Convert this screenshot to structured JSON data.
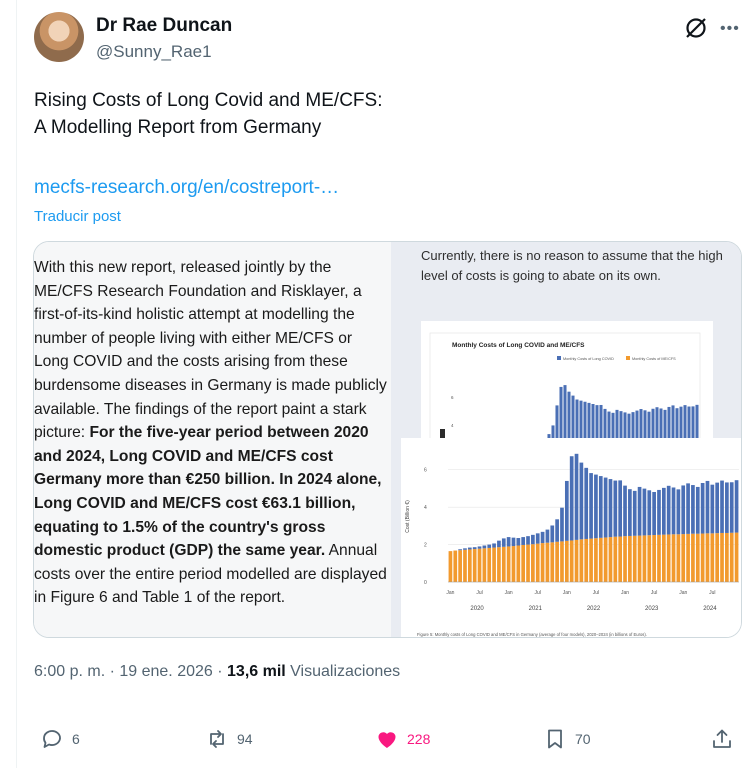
{
  "author": {
    "name": "Dr Rae Duncan",
    "handle": "@Sunny_Rae1"
  },
  "post": {
    "text_line1": "Rising Costs of Long Covid and ME/CFS:",
    "text_line2": "A Modelling Report from Germany",
    "link": "mecfs-research.org/en/costreport-…",
    "translate_label": "Traducir post"
  },
  "media": {
    "left_text_a": "With this new report, released jointly by the ME/CFS Research Foundation and Risklayer, a first-of-its-kind holistic attempt at modelling the number of people living with either ME/CFS or Long COVID and the costs arising from these burdensome diseases in Germany is made publicly available. The findings of the report paint a stark picture: ",
    "left_text_bold": "For the five-year period between 2020 and 2024, Long COVID and ME/CFS cost Germany more than €250 billion. In 2024 alone, Long COVID and ME/CFS cost €63.1 billion, equating to 1.5% of the country's gross domestic product (GDP) the same year.",
    "left_text_b": " Annual costs over the entire period modelled are displayed in Figure 6 and Table 1 of the report.",
    "right_text": "Currently, there is no reason to assume that the high level of costs is going to abate on its own.",
    "chart_title": "Monthly Costs of Long COVID and ME/CFS",
    "legend_lc": "Monthly Costs of Long COVID",
    "legend_me": "Monthly Costs of ME/CFS",
    "ylabel": "Cost (Billion €)",
    "month_ticks": [
      "Jan",
      "Jul",
      "Jan",
      "Jul",
      "Jan",
      "Jul",
      "Jan",
      "Jul",
      "Jan",
      "Jul"
    ],
    "year_ticks": [
      "2020",
      "2021",
      "2022",
      "2023",
      "2024"
    ],
    "y_ticks_big": [
      "0",
      "2",
      "4",
      "6"
    ],
    "y_ticks_small": [
      "6",
      "4"
    ],
    "caption": "Figure 5: Monthly costs of Long COVID and ME/CFS in Germany (average of four models), 2020–2024 (in billions of Euros)."
  },
  "chart_data": {
    "type": "bar",
    "title": "Monthly Costs of Long COVID and ME/CFS",
    "ylabel": "Cost (Billion €)",
    "ylim": [
      0,
      7
    ],
    "stacked": true,
    "legend": "top-right",
    "series": [
      {
        "name": "Monthly Costs of ME/CFS",
        "color": "#f29a2e",
        "values": [
          1.65,
          1.68,
          1.7,
          1.72,
          1.74,
          1.76,
          1.78,
          1.8,
          1.82,
          1.84,
          1.86,
          1.88,
          1.9,
          1.92,
          1.95,
          1.98,
          2.0,
          2.02,
          2.05,
          2.08,
          2.1,
          2.12,
          2.15,
          2.17,
          2.2,
          2.22,
          2.25,
          2.28,
          2.3,
          2.32,
          2.34,
          2.36,
          2.38,
          2.4,
          2.42,
          2.43,
          2.45,
          2.46,
          2.47,
          2.48,
          2.49,
          2.5,
          2.51,
          2.52,
          2.53,
          2.54,
          2.55,
          2.55,
          2.56,
          2.57,
          2.58,
          2.58,
          2.59,
          2.6,
          2.6,
          2.61,
          2.62,
          2.62,
          2.63,
          2.64
        ]
      },
      {
        "name": "Monthly Costs of Long COVID",
        "color": "#4a6fb5",
        "values": [
          0.0,
          0.0,
          0.05,
          0.08,
          0.1,
          0.1,
          0.12,
          0.15,
          0.18,
          0.22,
          0.35,
          0.45,
          0.5,
          0.45,
          0.4,
          0.42,
          0.45,
          0.5,
          0.55,
          0.6,
          0.7,
          0.9,
          1.2,
          1.8,
          3.2,
          4.5,
          4.6,
          4.1,
          3.8,
          3.5,
          3.4,
          3.3,
          3.2,
          3.1,
          3.0,
          3.0,
          2.7,
          2.5,
          2.4,
          2.6,
          2.5,
          2.4,
          2.3,
          2.4,
          2.5,
          2.6,
          2.5,
          2.4,
          2.6,
          2.7,
          2.6,
          2.5,
          2.7,
          2.8,
          2.6,
          2.7,
          2.8,
          2.7,
          2.7,
          2.8
        ]
      }
    ]
  },
  "meta": {
    "time": "6:00 p. m. · 19 ene. 2026 · ",
    "views_count": "13,6 mil",
    "views_label": " Visualizaciones"
  },
  "actions": {
    "reply_count": "6",
    "repost_count": "94",
    "like_count": "228",
    "bookmark_count": "70"
  },
  "colors": {
    "link": "#1d9bf0",
    "like": "#f91880",
    "muted": "#536471",
    "bar_lc": "#4a6fb5",
    "bar_me": "#f29a2e"
  }
}
